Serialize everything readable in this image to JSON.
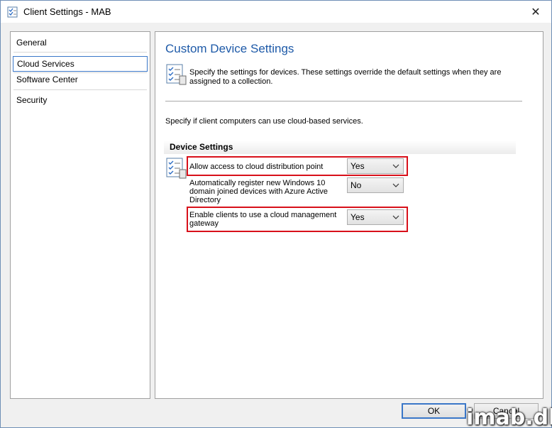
{
  "window": {
    "title": "Client Settings - MAB",
    "close_glyph": "✕"
  },
  "nav": {
    "items": [
      {
        "label": "General",
        "selected": false
      },
      {
        "label": "Cloud Services",
        "selected": true
      },
      {
        "label": "Software Center",
        "selected": false
      },
      {
        "label": "Security",
        "selected": false
      }
    ]
  },
  "content": {
    "heading": "Custom Device Settings",
    "description": "Specify the settings for devices. These settings override the default settings when they are assigned to a collection.",
    "specify": "Specify if client computers can use cloud-based services.",
    "section_title": "Device Settings",
    "settings": [
      {
        "label": "Allow access to cloud distribution point",
        "value": "Yes",
        "highlighted": true
      },
      {
        "label": "Automatically register new Windows 10 domain joined devices with Azure Active Directory",
        "value": "No",
        "highlighted": false
      },
      {
        "label": "Enable clients to use a cloud management gateway",
        "value": "Yes",
        "highlighted": true
      }
    ]
  },
  "buttons": {
    "ok": "OK",
    "cancel": "Cancel"
  },
  "watermark": "imab.dk",
  "icons": {
    "title": "checklist-icon",
    "description": "checklist-icon",
    "settings_row": "checklist-icon",
    "dropdown": "chevron-down-icon"
  },
  "colors": {
    "heading": "#1e5aa8",
    "highlight": "#d8101a",
    "selection": "#3a77c8"
  }
}
